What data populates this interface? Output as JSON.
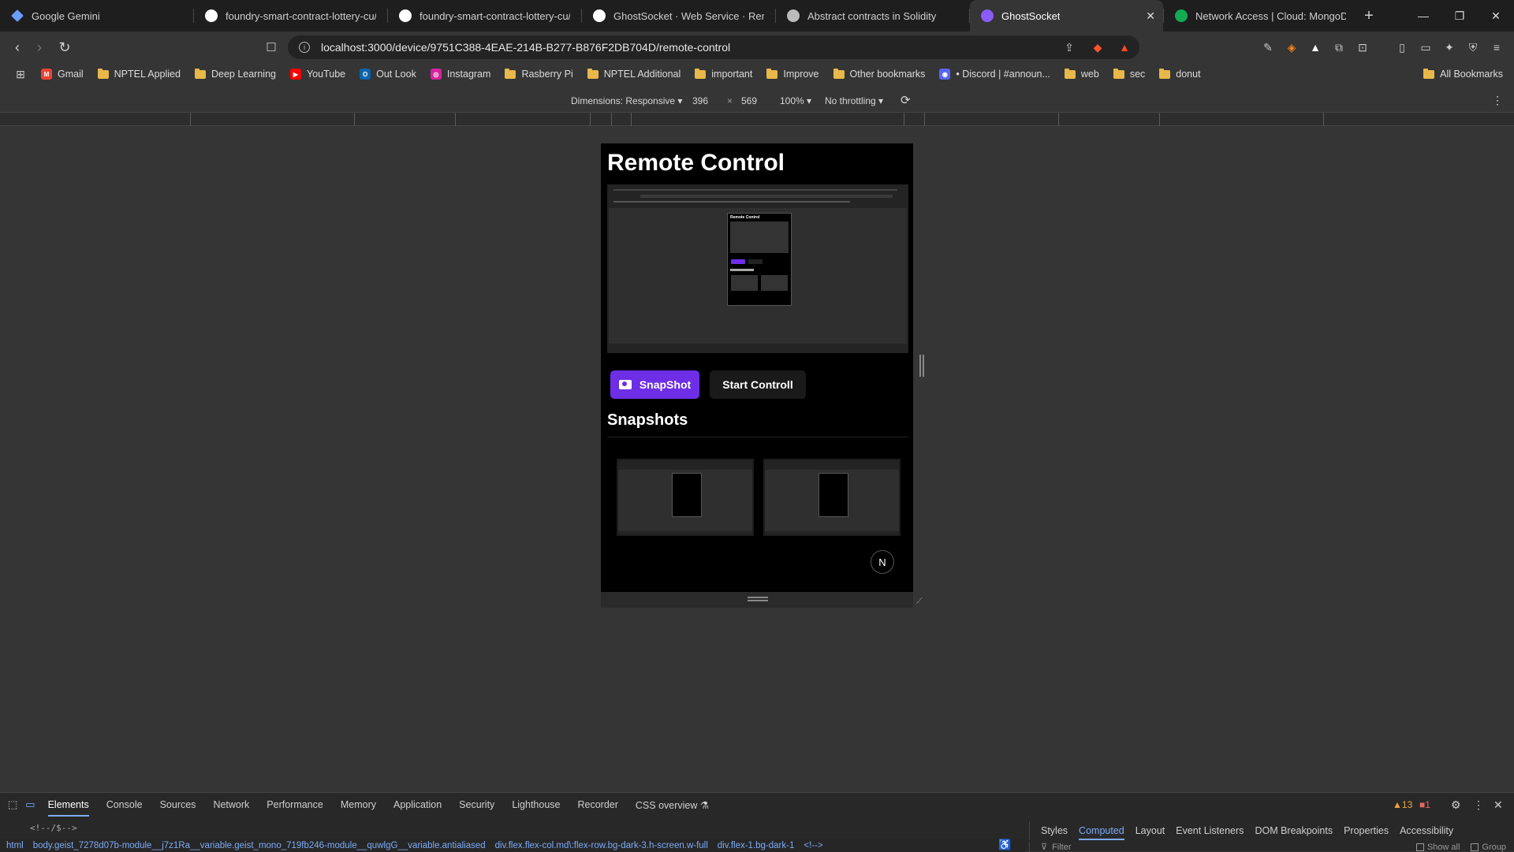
{
  "tabs": [
    {
      "label": "Google Gemini",
      "icon": "gemini-icon",
      "color": "#6b9cff"
    },
    {
      "label": "foundry-smart-contract-lottery-cu/s",
      "icon": "github-icon",
      "color": "#ffffff"
    },
    {
      "label": "foundry-smart-contract-lottery-cu/t",
      "icon": "github-icon",
      "color": "#ffffff"
    },
    {
      "label": "GhostSocket · Web Service · Render",
      "icon": "render-icon",
      "color": "#ffffff"
    },
    {
      "label": "Abstract contracts in Solidity",
      "icon": "globe-icon",
      "color": "#bbbbbb"
    },
    {
      "label": "GhostSocket",
      "icon": "ghostsocket-icon",
      "color": "#8a5cf6",
      "active": true
    },
    {
      "label": "Network Access | Cloud: MongoDB C",
      "icon": "mongodb-icon",
      "color": "#13aa52"
    }
  ],
  "address": {
    "url": "localhost:3000/device/9751C388-4EAE-214B-B277-B876F2DB704D/remote-control"
  },
  "bookmarks": [
    {
      "label": "Gmail",
      "type": "gmail"
    },
    {
      "label": "NPTEL Applied",
      "type": "folder"
    },
    {
      "label": "Deep Learning",
      "type": "folder"
    },
    {
      "label": "YouTube",
      "type": "youtube"
    },
    {
      "label": "Out Look",
      "type": "outlook"
    },
    {
      "label": "Instagram",
      "type": "instagram"
    },
    {
      "label": "Rasberry Pi",
      "type": "folder"
    },
    {
      "label": "NPTEL Additional",
      "type": "folder"
    },
    {
      "label": "important",
      "type": "folder"
    },
    {
      "label": "Improve",
      "type": "folder"
    },
    {
      "label": "Other bookmarks",
      "type": "folder"
    },
    {
      "label": "• Discord | #announ...",
      "type": "discord"
    },
    {
      "label": "web",
      "type": "folder"
    },
    {
      "label": "sec",
      "type": "folder"
    },
    {
      "label": "donut",
      "type": "folder"
    }
  ],
  "all_bookmarks": "All Bookmarks",
  "device_toolbar": {
    "dimensions": "Dimensions: Responsive ▾",
    "width": "396",
    "times": "×",
    "height": "569",
    "zoom": "100% ▾",
    "throttling": "No throttling ▾"
  },
  "app": {
    "title": "Remote Control",
    "snapshot_button": "SnapShot",
    "start_button": "Start Controll",
    "snapshots_heading": "Snapshots",
    "next_badge": "N"
  },
  "devtools": {
    "tabs": [
      "Elements",
      "Console",
      "Sources",
      "Network",
      "Performance",
      "Memory",
      "Application",
      "Security",
      "Lighthouse",
      "Recorder",
      "CSS overview ⚗"
    ],
    "active_tab": "Elements",
    "warnings": "13",
    "errors": "1",
    "code_line": "<!--/$-->",
    "breadcrumbs": [
      "html",
      "body.geist_7278d07b-module__j7z1Ra__variable.geist_mono_719fb246-module__quwlgG__variable.antialiased",
      "div.flex.flex-col.md\\:flex-row.bg-dark-3.h-screen.w-full",
      "div.flex-1.bg-dark-1",
      "<!-->"
    ],
    "side_tabs": [
      "Styles",
      "Computed",
      "Layout",
      "Event Listeners",
      "DOM Breakpoints",
      "Properties",
      "Accessibility"
    ],
    "active_side_tab": "Computed",
    "filter_placeholder": "Filter",
    "show_all": "Show all",
    "group": "Group"
  }
}
